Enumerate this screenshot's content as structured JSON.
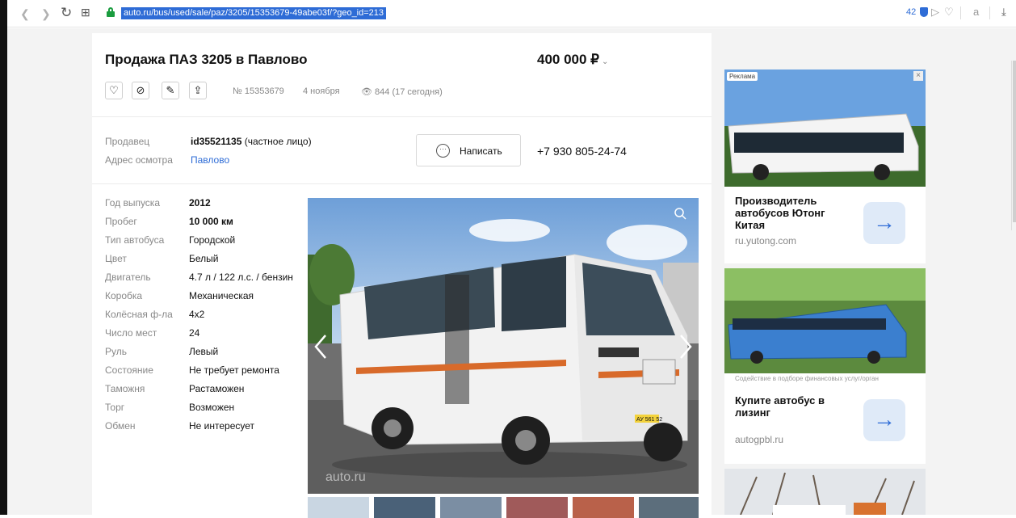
{
  "browser": {
    "url": "auto.ru/bus/used/sale/paz/3205/15353679-49abe03f/?geo_id=213",
    "counter": "42"
  },
  "listing": {
    "title": "Продажа ПАЗ 3205 в Павлово",
    "price": "400 000 ₽",
    "id_text": "№ 15353679",
    "date": "4 ноября",
    "views": "844 (17 сегодня)"
  },
  "seller": {
    "seller_label": "Продавец",
    "seller_id": "id35521135",
    "seller_type": " (частное лицо)",
    "address_label": "Адрес осмотра",
    "address_value": "Павлово",
    "write_button": "Написать",
    "phone": "+7 930 805-24-74"
  },
  "specs": [
    {
      "label": "Год выпуска",
      "value": "2012",
      "bold": true
    },
    {
      "label": "Пробег",
      "value": "10 000 км",
      "bold": true
    },
    {
      "label": "Тип автобуса",
      "value": "Городской"
    },
    {
      "label": "Цвет",
      "value": "Белый"
    },
    {
      "label": "Двигатель",
      "value": "4.7 л / 122 л.с. / бензин"
    },
    {
      "label": "Коробка",
      "value": "Механическая"
    },
    {
      "label": "Колёсная ф-ла",
      "value": "4x2"
    },
    {
      "label": "Число мест",
      "value": "24"
    },
    {
      "label": "Руль",
      "value": "Левый"
    },
    {
      "label": "Состояние",
      "value": "Не требует ремонта"
    },
    {
      "label": "Таможня",
      "value": "Растаможен"
    },
    {
      "label": "Торг",
      "value": "Возможен"
    },
    {
      "label": "Обмен",
      "value": "Не интересует"
    }
  ],
  "photo": {
    "watermark": "auto.ru",
    "plate": "АУ 561 52"
  },
  "ads": {
    "label": "Реклама",
    "ad1_title": "Производитель автобусов Ютонг Китая",
    "ad1_domain": "ru.yutong.com",
    "ad2_sub": "Содействие в подборе финансовых услуг/орган",
    "ad2_title": "Купите автобус в лизинг",
    "ad2_domain": "autogpbl.ru"
  }
}
